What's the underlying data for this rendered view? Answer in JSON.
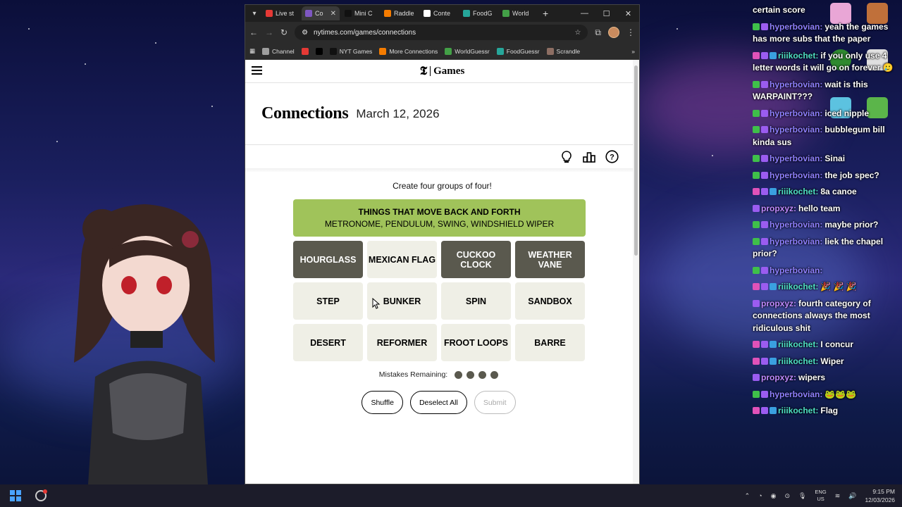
{
  "browser": {
    "tabs": [
      {
        "label": "Live st",
        "fav": "#e53935",
        "active": false
      },
      {
        "label": "Co",
        "fav": "#7e57c2",
        "active": true
      },
      {
        "label": "Mini C",
        "fav": "#111111",
        "active": false
      },
      {
        "label": "Raddle",
        "fav": "#f57c00",
        "active": false
      },
      {
        "label": "Conte",
        "fav": "#ffffff",
        "active": false
      },
      {
        "label": "FoodG",
        "fav": "#26a69a",
        "active": false
      },
      {
        "label": "World",
        "fav": "#43a047",
        "active": false
      }
    ],
    "url": "nytimes.com/games/connections",
    "bookmarks": [
      {
        "label": "Channel",
        "color": "#9e9e9e"
      },
      {
        "label": "",
        "color": "#e53935"
      },
      {
        "label": "",
        "color": "#000000"
      },
      {
        "label": "NYT Games",
        "color": "#111111"
      },
      {
        "label": "More Connections",
        "color": "#f57c00"
      },
      {
        "label": "WorldGuessr",
        "color": "#43a047"
      },
      {
        "label": "FoodGuessr",
        "color": "#26a69a"
      },
      {
        "label": "Scrandle",
        "color": "#8d6e63"
      }
    ]
  },
  "game": {
    "brand": "Games",
    "title": "Connections",
    "date": "March 12, 2026",
    "instructions": "Create four groups of four!",
    "solved": [
      {
        "category": "THINGS THAT MOVE BACK AND FORTH",
        "members": "METRONOME, PENDULUM, SWING, WINDSHIELD WIPER",
        "color": "#a0c35a"
      }
    ],
    "rows": [
      [
        {
          "word": "HOURGLASS",
          "selected": true
        },
        {
          "word": "MEXICAN FLAG",
          "selected": false
        },
        {
          "word": "CUCKOO CLOCK",
          "selected": true
        },
        {
          "word": "WEATHER VANE",
          "selected": true
        }
      ],
      [
        {
          "word": "STEP",
          "selected": false
        },
        {
          "word": "BUNKER",
          "selected": false
        },
        {
          "word": "SPIN",
          "selected": false
        },
        {
          "word": "SANDBOX",
          "selected": false
        }
      ],
      [
        {
          "word": "DESERT",
          "selected": false
        },
        {
          "word": "REFORMER",
          "selected": false
        },
        {
          "word": "FROOT LOOPS",
          "selected": false
        },
        {
          "word": "BARRE",
          "selected": false
        }
      ]
    ],
    "mistakes_label": "Mistakes Remaining:",
    "mistakes_remaining": 4,
    "buttons": {
      "shuffle": "Shuffle",
      "deselect": "Deselect All",
      "submit": "Submit"
    }
  },
  "chat": [
    {
      "user": "",
      "text": "certain score",
      "badges": []
    },
    {
      "user": "hyperbovian:",
      "text": "yeah the games has more subs that the paper",
      "badges": [
        "green",
        "purple"
      ],
      "cls": "hyper"
    },
    {
      "user": "riiikochet:",
      "text": "if you only use 4 letter words it will go on forever 🥲",
      "badges": [
        "pink",
        "purple",
        "blue"
      ],
      "cls": "riii"
    },
    {
      "user": "hyperbovian:",
      "text": "wait is this WARPAINT???",
      "badges": [
        "green",
        "purple"
      ],
      "cls": "hyper"
    },
    {
      "user": "hyperbovian:",
      "text": "iced nipple",
      "badges": [
        "green",
        "purple"
      ],
      "cls": "hyper"
    },
    {
      "user": "hyperbovian:",
      "text": "bubblegum bill kinda sus",
      "badges": [
        "green",
        "purple"
      ],
      "cls": "hyper"
    },
    {
      "user": "hyperbovian:",
      "text": "Sinai",
      "badges": [
        "green",
        "purple"
      ],
      "cls": "hyper"
    },
    {
      "user": "hyperbovian:",
      "text": "the job spec?",
      "badges": [
        "green",
        "purple"
      ],
      "cls": "hyper"
    },
    {
      "user": "riiikochet:",
      "text": "8a canoe",
      "badges": [
        "pink",
        "purple",
        "blue"
      ],
      "cls": "riii"
    },
    {
      "user": "propxyz:",
      "text": "hello team",
      "badges": [
        "purple"
      ],
      "cls": "prop"
    },
    {
      "user": "hyperbovian:",
      "text": "maybe prior?",
      "badges": [
        "green",
        "purple"
      ],
      "cls": "hyper"
    },
    {
      "user": "hyperbovian:",
      "text": "liek the chapel prior?",
      "badges": [
        "green",
        "purple"
      ],
      "cls": "hyper"
    },
    {
      "user": "hyperbovian:",
      "text": "",
      "badges": [
        "green",
        "purple"
      ],
      "cls": "hyper"
    },
    {
      "user": "riiikochet:",
      "text": "🎉 🎉 🎉",
      "badges": [
        "pink",
        "purple",
        "blue"
      ],
      "cls": "riii"
    },
    {
      "user": "propxyz:",
      "text": "fourth category of connections always the most ridiculous shit",
      "badges": [
        "purple"
      ],
      "cls": "prop"
    },
    {
      "user": "riiikochet:",
      "text": "I concur",
      "badges": [
        "pink",
        "purple",
        "blue"
      ],
      "cls": "riii"
    },
    {
      "user": "riiikochet:",
      "text": "Wiper",
      "badges": [
        "pink",
        "purple",
        "blue"
      ],
      "cls": "riii"
    },
    {
      "user": "propxyz:",
      "text": "wipers",
      "badges": [
        "purple"
      ],
      "cls": "prop"
    },
    {
      "user": "hyperbovian:",
      "text": "🐸🐸🐸",
      "badges": [
        "green",
        "purple"
      ],
      "cls": "hyper"
    },
    {
      "user": "riiikochet:",
      "text": "Flag",
      "badges": [
        "pink",
        "purple",
        "blue"
      ],
      "cls": "riii"
    }
  ],
  "taskbar": {
    "lang": "ENG",
    "region": "US",
    "time": "9:15 PM",
    "date": "12/03/2026"
  }
}
